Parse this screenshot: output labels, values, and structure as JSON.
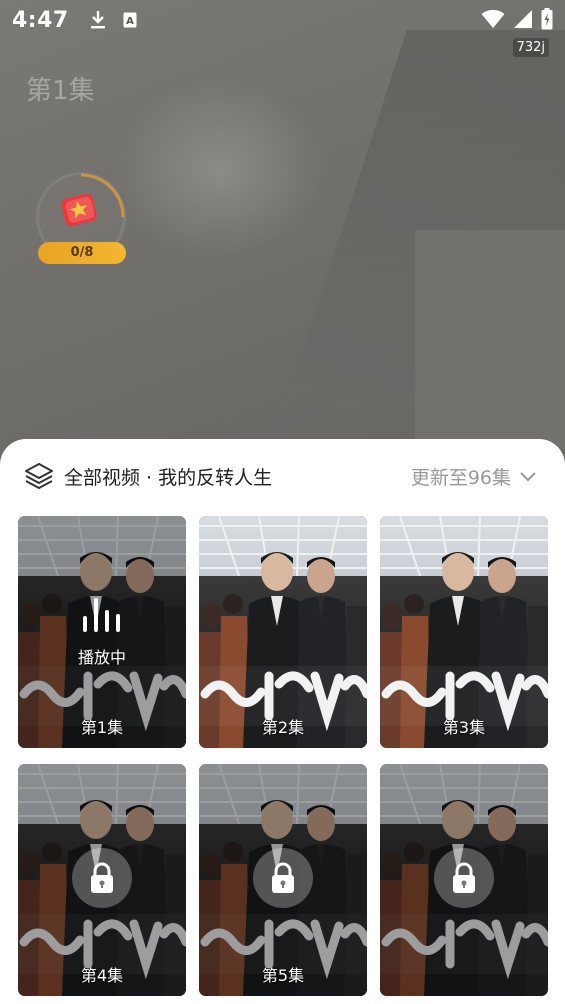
{
  "status_bar": {
    "time": "4:47",
    "speed": "732j",
    "icons": [
      "download-icon",
      "a-icon",
      "wifi-icon",
      "signal-icon",
      "battery-icon"
    ]
  },
  "player": {
    "episode_title": "第1集",
    "reward_progress": "0/8",
    "reward_icon": "gift-icon"
  },
  "sheet": {
    "icon": "layers-icon",
    "title": "全部视频 · 我的反转人生",
    "update_text": "更新至96集",
    "update_icon": "chevron-down-icon",
    "episodes": [
      {
        "label": "第1集",
        "status": "playing",
        "status_text": "播放中",
        "icon": "equalizer-icon"
      },
      {
        "label": "第2集",
        "status": "unlocked"
      },
      {
        "label": "第3集",
        "status": "unlocked"
      },
      {
        "label": "第4集",
        "status": "locked",
        "icon": "lock-icon"
      },
      {
        "label": "第5集",
        "status": "locked",
        "icon": "lock-icon"
      },
      {
        "label": "",
        "status": "locked",
        "icon": "lock-icon"
      }
    ]
  },
  "colors": {
    "reward_pill": "#f2b731",
    "sheet_bg": "#ffffff",
    "muted_text": "#999999"
  }
}
